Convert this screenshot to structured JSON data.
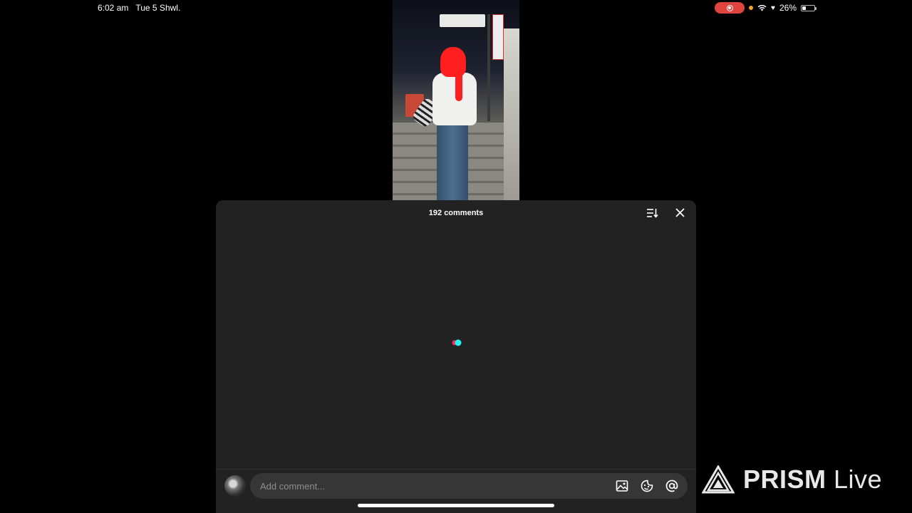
{
  "status_bar": {
    "time": "6:02 am",
    "date": "Tue 5 Shwl.",
    "battery": "26%",
    "battery_level": 0.26
  },
  "comments_panel": {
    "title": "192 comments",
    "input_placeholder": "Add comment...",
    "sort_icon": "sort-icon",
    "close_icon": "close-icon",
    "image_icon": "image-icon",
    "emoji_icon": "emoji-icon",
    "mention_icon": "at-mention-icon"
  },
  "watermark": {
    "brand": "PRISM",
    "suffix": "Live"
  },
  "colors": {
    "sheet_bg": "#222222",
    "input_bg": "#363636",
    "record_red": "#e0443f",
    "spinner_red": "#fe2c55",
    "spinner_cyan": "#25f4ee"
  }
}
